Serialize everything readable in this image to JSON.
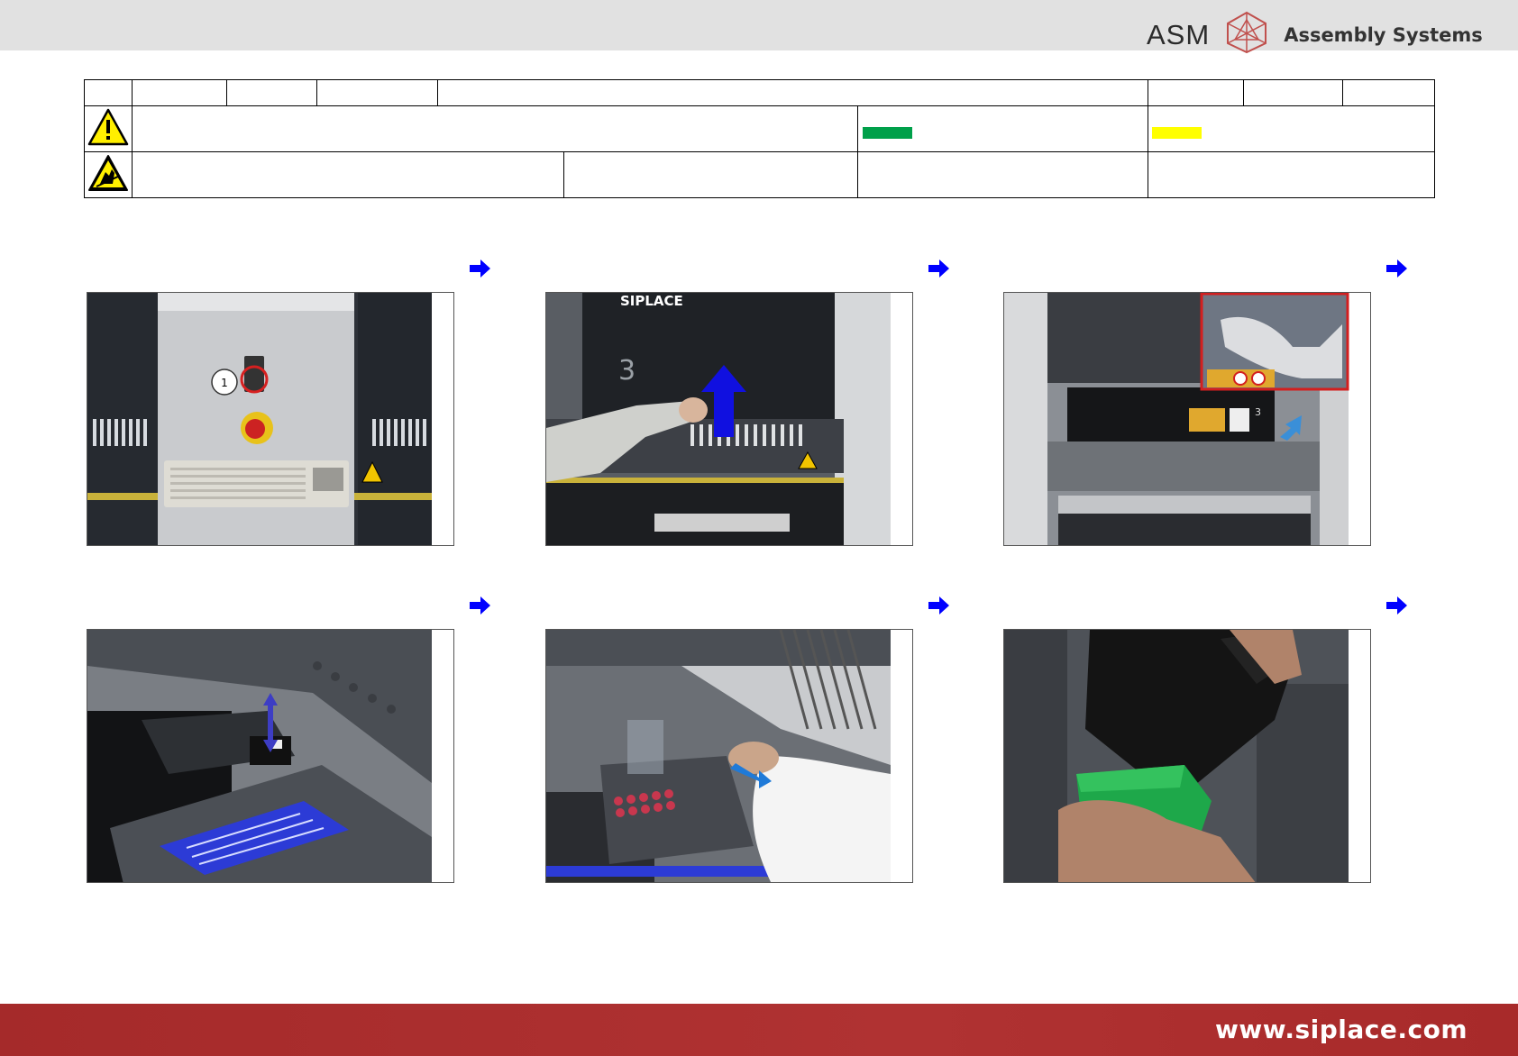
{
  "header": {
    "logo_text": "ASM",
    "brand_text": "Assembly Systems",
    "background_color": "#e1e1e1"
  },
  "info_table": {
    "warning_icon": "warning-triangle-icon",
    "esd_icon": "esd-hand-icon",
    "status_colors": {
      "green": "#00a04a",
      "yellow": "#ffff00"
    }
  },
  "steps": [
    {
      "icon": "arrow-right-icon",
      "photo": "machine-control-panel-with-keyboard"
    },
    {
      "icon": "arrow-right-icon",
      "photo": "opening-machine-hood-siplace"
    },
    {
      "icon": "arrow-right-icon",
      "photo": "placement-head-gantry"
    },
    {
      "icon": "arrow-right-icon",
      "photo": "nozzle-change-slide-up-arrow"
    },
    {
      "icon": "arrow-right-icon",
      "photo": "nozzle-changer-removal"
    },
    {
      "icon": "arrow-right-icon",
      "photo": "emptying-waste-bin"
    }
  ],
  "photo_texts": {
    "callout_number": "1",
    "machine_brand": "SIPLACE",
    "gantry_number": "3"
  },
  "footer": {
    "url": "www.siplace.com",
    "background_color": "#a52a2a"
  }
}
